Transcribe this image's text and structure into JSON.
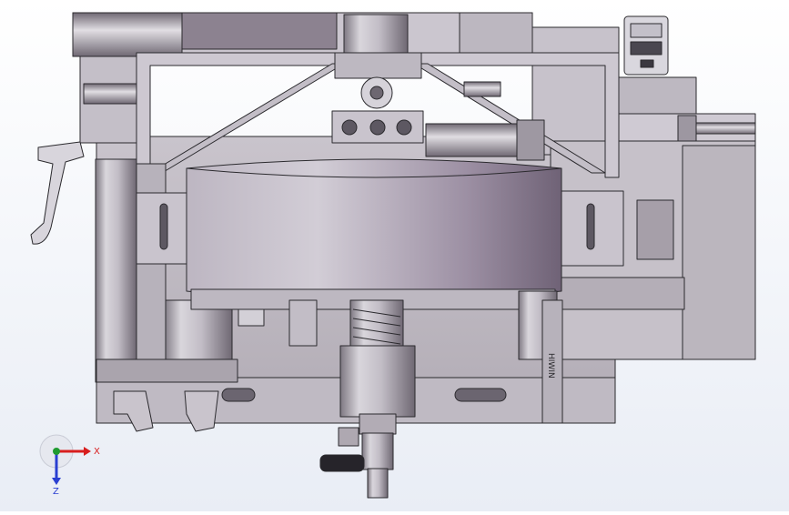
{
  "viewport": {
    "background_top": "#ffffff",
    "background_bottom": "#e9edf5",
    "metal_light": "#d8d5dc",
    "metal_mid": "#b9b4bd",
    "metal_dark": "#7e7882",
    "purple_tint": "#8c8290",
    "edge": "#2b2a2e"
  },
  "model": {
    "side_stamp": "HIWIN"
  },
  "triad": {
    "x_label": "X",
    "z_label": "Z",
    "x_color": "#d81e1e",
    "z_color": "#2a3fd1",
    "y_color": "#1f9a2f"
  }
}
